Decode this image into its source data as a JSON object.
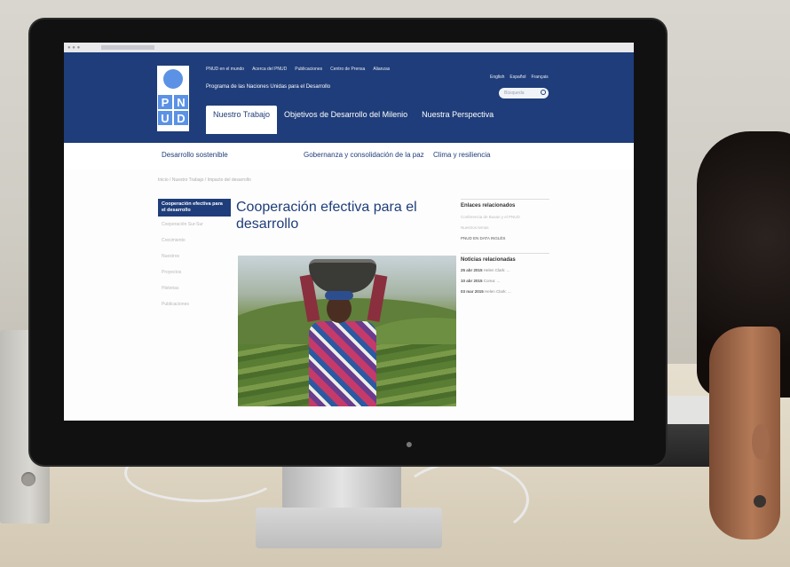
{
  "browser": {
    "url_text": "www.pnud.org"
  },
  "header": {
    "logo_letters": [
      "P",
      "N",
      "U",
      "D"
    ],
    "top_links": [
      "PNUD en el mundo",
      "Acerca del PNUD",
      "Publicaciones",
      "Centro de Prensa",
      "Alianzas"
    ],
    "languages": [
      "English",
      "Español",
      "Français"
    ],
    "tagline": "Programa de las Naciones Unidas para el Desarrollo",
    "search_placeholder": "Búsqueda"
  },
  "tabs": [
    "Nuestro Trabajo",
    "Objetivos de Desarrollo del Milenio",
    "Nuestra Perspectiva"
  ],
  "subnav": [
    "Desarrollo sostenible",
    "Gobernanza y consolidación de la paz",
    "Clima y resiliencia"
  ],
  "breadcrumb": "Inicio  /  Nuestro Trabajo  /  Impacto del desarrollo",
  "sidebar": {
    "active": "Cooperación efectiva para el desarrollo",
    "items": [
      "Cooperación Sur-Sur",
      "Crecimiento",
      "Nuestros",
      "Proyectos",
      "Historias",
      "Publicaciones"
    ]
  },
  "main": {
    "title": "Cooperación efectiva para el desarrollo",
    "photo_caption": ""
  },
  "right": {
    "links_heading": "Enlaces relacionados",
    "links": [
      "Conferencia de Busan y el PNUD",
      "Nuestros temas"
    ],
    "caps_link": "PNUD EN DATA INGLÉS",
    "news_heading": "Noticias relacionadas",
    "news": [
      {
        "date": "25 abr 2015",
        "text": "Helen Clark: ..."
      },
      {
        "date": "10 abr 2015",
        "text": "Corea: ..."
      },
      {
        "date": "03 mar 2015",
        "text": "Helen Clark: ..."
      }
    ]
  },
  "colors": {
    "brand_blue": "#1f3d7a",
    "accent_blue": "#5b92e5"
  }
}
